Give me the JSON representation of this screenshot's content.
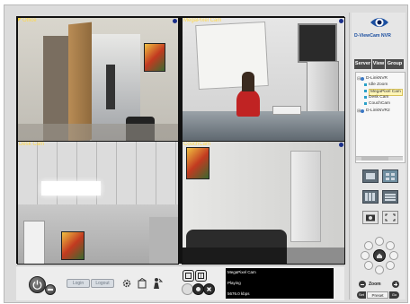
{
  "cameras": [
    {
      "title": "Office"
    },
    {
      "title": "MegaPixel Cam"
    },
    {
      "title": "Desk Cam"
    },
    {
      "title": "CouchCam"
    }
  ],
  "controls": {
    "login_label": "Login",
    "logout_label": "Logout"
  },
  "info": {
    "camera_name": "MegaPixel Cam",
    "status": "Playing",
    "bitrate": "5676.0 kbps"
  },
  "sidebar": {
    "logo_text": "D-ViewCam NVR",
    "tabs": [
      "Server",
      "View",
      "Group"
    ],
    "tree": [
      {
        "label": "D-LinkNVR"
      },
      {
        "label": "Idle Zoom"
      },
      {
        "label": "MegaPixel Cam"
      },
      {
        "label": "Desk Cam"
      },
      {
        "label": "CouchCam"
      },
      {
        "label": "D-LinkNVR2"
      }
    ],
    "zoom_label": "Zoom",
    "preset_label": "Preset",
    "set_label": "Set",
    "go_label": "Go"
  },
  "colors": {
    "camera_title": "#ffd84a",
    "camera_dot": "#1a2f8a",
    "tab_bg": "#4c4c4c"
  }
}
